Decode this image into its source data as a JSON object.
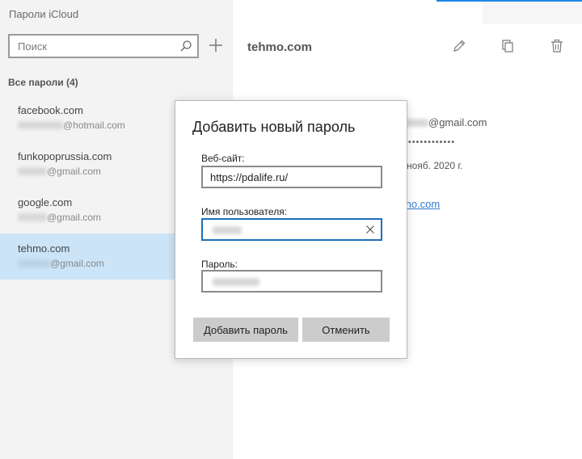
{
  "app": {
    "title": "Пароли iCloud"
  },
  "sidebar": {
    "search_placeholder": "Поиск",
    "section_label": "Все пароли (4)",
    "items": [
      {
        "site": "facebook.com",
        "user_suffix": "@hotmail.com",
        "selected": false
      },
      {
        "site": "funkopoprussia.com",
        "user_suffix": "@gmail.com",
        "selected": false
      },
      {
        "site": "google.com",
        "user_suffix": "@gmail.com",
        "selected": false
      },
      {
        "site": "tehmo.com",
        "user_suffix": "@gmail.com",
        "selected": true
      }
    ]
  },
  "detail": {
    "title": "tehmo.com",
    "user_suffix": "@gmail.com",
    "password_mask": "•••••••••••••",
    "date_partial": "нояб. 2020 г.",
    "link_partial": "mo.com"
  },
  "dialog": {
    "title": "Добавить новый пароль",
    "website_label": "Веб-сайт:",
    "website_value": "https://pdalife.ru/",
    "username_label": "Имя пользователя:",
    "password_label": "Пароль:",
    "add_button": "Добавить пароль",
    "cancel_button": "Отменить"
  },
  "icons": {
    "search": "search-icon",
    "add": "plus-icon",
    "edit": "pencil-icon",
    "copy": "copy-icon",
    "delete": "trash-icon",
    "clear": "close-icon"
  },
  "colors": {
    "accent": "#1f6fb8",
    "selected_bg": "#cce4f7",
    "link": "#2d7bd1"
  }
}
